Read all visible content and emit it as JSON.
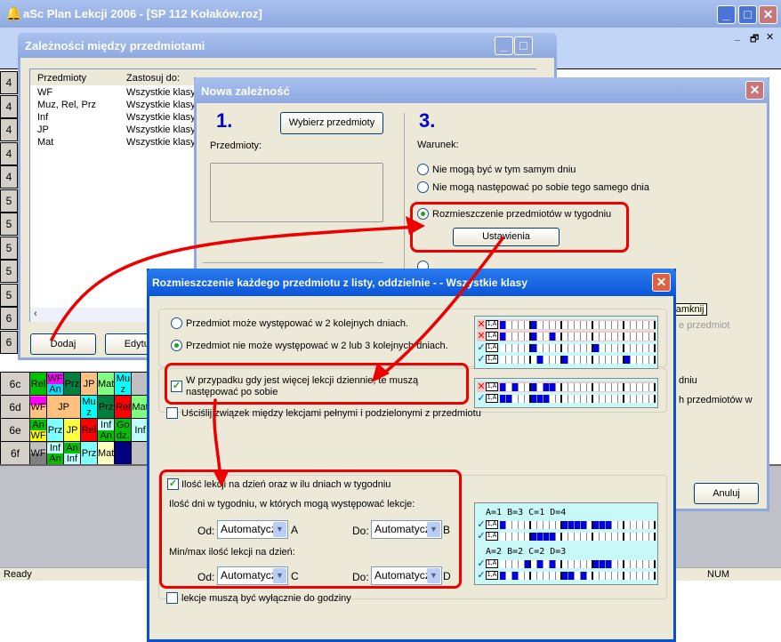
{
  "app": {
    "title": "aSc Plan Lekcji 2006  - [SP 112 Kołaków.roz]",
    "status": "Ready",
    "num": "NUM"
  },
  "grid": {
    "row_labels": [
      "4",
      "4",
      "4",
      "4",
      "4",
      "5",
      "5",
      "5",
      "5",
      "5",
      "6",
      "6"
    ]
  },
  "timetable": [
    {
      "label": "6c",
      "cells": [
        {
          "t": "Rel",
          "c": "#00c000"
        },
        {
          "t": "WF",
          "b": "An",
          "c": "#ff00ff",
          "c2": "#00e0ff"
        },
        {
          "t": "Prz",
          "c": "#008040"
        },
        {
          "t": "JP",
          "c": "#ffc080"
        },
        {
          "t": "Mat",
          "c": "#80ff80"
        },
        {
          "t": "Mu z",
          "c": "#00ffff"
        },
        {
          "t": "",
          "c": "#c0c0c0"
        }
      ]
    },
    {
      "label": "6d",
      "cells": [
        {
          "t": "WF",
          "c": "#ff00ff",
          "c2": "#ffc080"
        },
        {
          "t": "JP",
          "c": "#ffc080",
          "span": 2
        },
        {
          "t": "Mu z",
          "c": "#00ffff"
        },
        {
          "t": "Prz",
          "c": "#008040"
        },
        {
          "t": "Rel",
          "c": "#ff0000"
        },
        {
          "t": "Mat",
          "c": "#80ff80"
        }
      ]
    },
    {
      "label": "6e",
      "cells": [
        {
          "t": "An",
          "b": "WF",
          "c": "#00c000",
          "c2": "#ffff00"
        },
        {
          "t": "Prz",
          "c": "#80ffff"
        },
        {
          "t": "JP",
          "c": "#ffff40"
        },
        {
          "t": "Rel",
          "c": "#ff0000"
        },
        {
          "t": "Inf",
          "b": "An",
          "c": "#c0ffff",
          "c2": "#00c000"
        },
        {
          "t": "Go dz.",
          "c": "#00c000"
        },
        {
          "t": "Inf",
          "c": "#c0ffff"
        }
      ]
    },
    {
      "label": "6f",
      "cells": [
        {
          "t": "",
          "b": "WF",
          "c": "#c0c0c0",
          "c2": "#808080"
        },
        {
          "t": "Inf",
          "b": "An",
          "c": "#c0ffff",
          "c2": "#00c000"
        },
        {
          "t": "An",
          "b": "Inf",
          "c": "#00c000",
          "c2": "#c0ffff"
        },
        {
          "t": "Prz",
          "c": "#80ffff"
        },
        {
          "t": "Mat",
          "c": "#ffffc0"
        },
        {
          "t": "",
          "c": "#000080"
        },
        {
          "t": "",
          "c": "#c0c0c0"
        }
      ]
    }
  ],
  "dlg1": {
    "title": "Zależności między przedmiotami",
    "columns": [
      "Przedmioty",
      "Zastosuj do:"
    ],
    "rows": [
      [
        "WF",
        "Wszystkie klasy"
      ],
      [
        "Muz, Rel, Prz",
        "Wszystkie klasy"
      ],
      [
        "Inf",
        "Wszystkie klasy"
      ],
      [
        "JP",
        "Wszystkie klasy"
      ],
      [
        "Mat",
        "Wszystkie klasy"
      ]
    ],
    "add": "Dodaj",
    "edit": "Edytuj"
  },
  "dlg2": {
    "title": "Nowa zależność",
    "step1": "1.",
    "choose": "Wybierz przedmioty",
    "subjects_label": "Przedmioty:",
    "step3": "3.",
    "condition": "Warunek:",
    "options": [
      "Nie mogą być w tym samym dniu",
      "Nie mogą następować po sobie tego samego dnia",
      "Rozmieszczenie przedmiotów w tygodniu"
    ],
    "settings": "Ustawienia",
    "frag1": "e przedmiot",
    "frag2": "dniu",
    "frag3": "h przedmiotów w",
    "cancel": "Anuluj",
    "tooltip": "Zamknij"
  },
  "dlg3": {
    "title": "Rozmieszczenie każdego przedmiotu z listy, oddzielnie -  - Wszystkie klasy",
    "radio1": "Przedmiot może występować w 2 kolejnych dniach.",
    "radio2": "Przedmiot nie może występować w 2 lub 3 kolejnych dniach.",
    "consecutive": "W przypadku gdy jest więcej lekcji dziennie, te muszą następować po sobie",
    "relation": "Uściślij związek między lekcjami pełnymi i podzielonymi z przedmiotu",
    "count": "Ilość lekcji na dzień oraz w ilu dniach w tygodniu",
    "days_label": "Ilość dni w tygodniu, w których mogą występować lekcje:",
    "minmax_label": "Min/max ilość lekcji na dzień:",
    "from": "Od:",
    "to": "Do:",
    "sel_a": "Automatyczi",
    "sel_b": "Automatycz",
    "sel_c": "Automatyczi",
    "sel_d": "Automatyczi",
    "letters": [
      "A",
      "B",
      "C",
      "D"
    ],
    "hours_only": "lekcje muszą być wyłącznie do godziny"
  },
  "patterns": {
    "icon_label": "1,A",
    "box1": [
      {
        "ok": false,
        "on": [
          0,
          5
        ]
      },
      {
        "ok": false,
        "on": [
          0,
          5,
          8
        ]
      },
      {
        "ok": true,
        "on": [
          5,
          15
        ]
      },
      {
        "ok": true,
        "on": [
          6,
          10,
          20
        ]
      }
    ],
    "box2": [
      {
        "ok": false,
        "on": [
          0,
          2,
          5,
          7,
          8
        ]
      },
      {
        "ok": true,
        "on": [
          0,
          1,
          5,
          6,
          7
        ]
      }
    ],
    "box3a_label": "A=1 B=3 C=1 D=4",
    "box3a": [
      {
        "ok": true,
        "on": [
          0,
          10,
          11,
          12,
          13,
          15,
          16,
          17
        ]
      },
      {
        "ok": true,
        "on": [
          5,
          6,
          7,
          8
        ]
      }
    ],
    "box3b_label": "A=2 B=2 C=2 D=3",
    "box3b": [
      {
        "ok": true,
        "on": [
          4,
          6,
          8,
          15,
          16,
          17
        ]
      },
      {
        "ok": true,
        "on": [
          0,
          2,
          10,
          11,
          13
        ]
      }
    ]
  },
  "colors": {
    "annotation": "#e00000",
    "xp_title": "#0a5fe0",
    "dialog_bg": "#ece9d8"
  }
}
